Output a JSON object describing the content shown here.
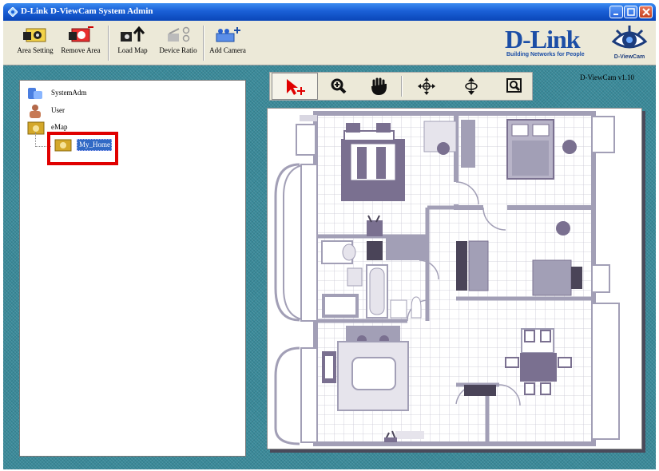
{
  "window": {
    "title": "D-Link D-ViewCam System Admin"
  },
  "toolbar": {
    "items": [
      {
        "label": "Area Setting",
        "icon": "area-setting-icon"
      },
      {
        "label": "Remove Area",
        "icon": "remove-area-icon"
      },
      {
        "label": "Load Map",
        "icon": "load-map-icon"
      },
      {
        "label": "Device Ratio",
        "icon": "device-ratio-icon"
      },
      {
        "label": "Add Camera",
        "icon": "add-camera-icon"
      }
    ]
  },
  "brand": {
    "name": "D-Link",
    "tagline": "Building Networks for People",
    "product": "D-ViewCam"
  },
  "tree": {
    "items": [
      {
        "label": "SystemAdm",
        "icon": "system-admin-icon"
      },
      {
        "label": "User",
        "icon": "user-icon"
      },
      {
        "label": "eMap",
        "icon": "emap-icon"
      },
      {
        "label": "My_Home",
        "icon": "map-folder-icon",
        "selected": true
      }
    ]
  },
  "map_tools": {
    "items": [
      {
        "icon": "select-pointer-icon"
      },
      {
        "icon": "zoom-in-icon"
      },
      {
        "icon": "pan-hand-icon"
      },
      {
        "icon": "move-horizontal-icon"
      },
      {
        "icon": "move-vertical-icon"
      },
      {
        "icon": "zoom-fit-icon"
      }
    ]
  },
  "version": "D-ViewCam v1.10",
  "colors": {
    "titlebar": "#0a46b8",
    "workspace": "#3a8a9a",
    "selection_highlight": "#e00000",
    "selected_item": "#316ac5"
  }
}
